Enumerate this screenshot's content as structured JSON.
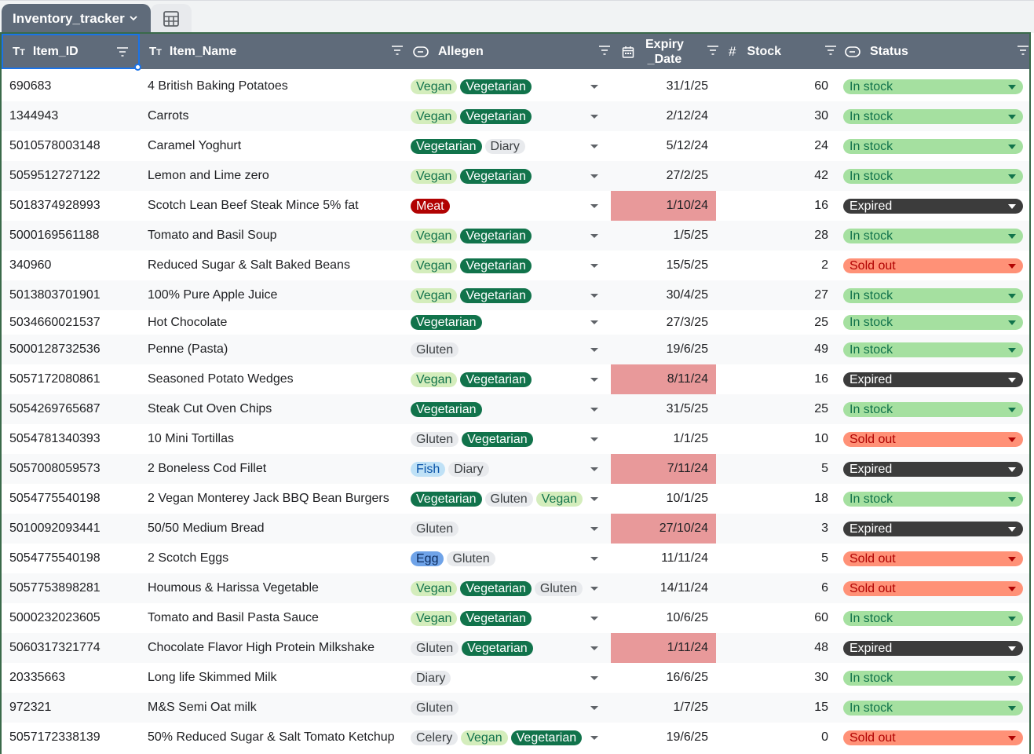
{
  "tabs": {
    "sheet_name": "Inventory_tracker"
  },
  "columns": [
    {
      "key": "item_id",
      "label": "Item_ID",
      "type_icon": "text-type-icon"
    },
    {
      "key": "item_name",
      "label": "Item_Name",
      "type_icon": "text-type-icon"
    },
    {
      "key": "allergen",
      "label": "Allegen",
      "type_icon": "dropdown-chip-icon"
    },
    {
      "key": "expiry",
      "label": "Expiry\n_Date",
      "type_icon": "calendar-icon"
    },
    {
      "key": "stock",
      "label": "Stock",
      "type_icon": "number-hash-icon"
    },
    {
      "key": "status",
      "label": "Status",
      "type_icon": "dropdown-chip-icon"
    }
  ],
  "chip_styles": {
    "Vegan": {
      "bg": "#d4edbc",
      "fg": "#11734b"
    },
    "Vegetarian": {
      "bg": "#11734b",
      "fg": "#ffffff"
    },
    "Diary": {
      "bg": "#e8eaed",
      "fg": "#3c4043"
    },
    "Gluten": {
      "bg": "#e8eaed",
      "fg": "#3c4043"
    },
    "Meat": {
      "bg": "#b10202",
      "fg": "#ffffff"
    },
    "Fish": {
      "bg": "#bfe1f6",
      "fg": "#0a53a8"
    },
    "Egg": {
      "bg": "#6fa3e8",
      "fg": "#0b2a5c"
    },
    "Celery": {
      "bg": "#e8eaed",
      "fg": "#3c4043"
    }
  },
  "status_styles": {
    "In stock": {
      "bg": "#a5e0a0",
      "fg": "#11734b",
      "arrow": "#11734b"
    },
    "Expired": {
      "bg": "#3c3c3c",
      "fg": "#ffffff",
      "arrow": "#ffffff"
    },
    "Sold out": {
      "bg": "#ff9177",
      "fg": "#b10202",
      "arrow": "#b10202"
    }
  },
  "rows": [
    {
      "id": "690683",
      "name": "4 British Baking Potatoes",
      "allergens": [
        "Vegan",
        "Vegetarian"
      ],
      "date": "31/1/25",
      "expired": false,
      "stock": "60",
      "status": "In stock"
    },
    {
      "id": "1344943",
      "name": "Carrots",
      "allergens": [
        "Vegan",
        "Vegetarian"
      ],
      "date": "2/12/24",
      "expired": false,
      "stock": "30",
      "status": "In stock"
    },
    {
      "id": "5010578003148",
      "name": "Caramel Yoghurt",
      "allergens": [
        "Vegetarian",
        "Diary"
      ],
      "date": "5/12/24",
      "expired": false,
      "stock": "24",
      "status": "In stock"
    },
    {
      "id": "5059512727122",
      "name": "Lemon and Lime zero",
      "allergens": [
        "Vegan",
        "Vegetarian"
      ],
      "date": "27/2/25",
      "expired": false,
      "stock": "42",
      "status": "In stock"
    },
    {
      "id": "5018374928993",
      "name": "Scotch Lean Beef Steak Mince 5% fat",
      "allergens": [
        "Meat"
      ],
      "date": "1/10/24",
      "expired": true,
      "stock": "16",
      "status": "Expired"
    },
    {
      "id": "5000169561188",
      "name": "Tomato and Basil Soup",
      "allergens": [
        "Vegan",
        "Vegetarian"
      ],
      "date": "1/5/25",
      "expired": false,
      "stock": "28",
      "status": "In stock"
    },
    {
      "id": "340960",
      "name": "Reduced Sugar & Salt Baked Beans",
      "allergens": [
        "Vegan",
        "Vegetarian"
      ],
      "date": "15/5/25",
      "expired": false,
      "stock": "2",
      "status": "Sold out"
    },
    {
      "id": "5013803701901",
      "name": "100% Pure Apple Juice",
      "allergens": [
        "Vegan",
        "Vegetarian"
      ],
      "date": "30/4/25",
      "expired": false,
      "stock": "27",
      "status": "In stock"
    },
    {
      "id": "5034660021537",
      "name": "Hot Chocolate",
      "allergens": [
        "Vegetarian"
      ],
      "date": "27/3/25",
      "expired": false,
      "stock": "25",
      "status": "In stock"
    },
    {
      "id": "5000128732536",
      "name": "Penne (Pasta)",
      "allergens": [
        "Gluten"
      ],
      "date": "19/6/25",
      "expired": false,
      "stock": "49",
      "status": "In stock"
    },
    {
      "id": "5057172080861",
      "name": "Seasoned Potato Wedges",
      "allergens": [
        "Vegan",
        "Vegetarian"
      ],
      "date": "8/11/24",
      "expired": true,
      "stock": "16",
      "status": "Expired"
    },
    {
      "id": "5054269765687",
      "name": "Steak Cut Oven Chips",
      "allergens": [
        "Vegetarian"
      ],
      "date": "31/5/25",
      "expired": false,
      "stock": "25",
      "status": "In stock"
    },
    {
      "id": "5054781340393",
      "name": "10 Mini Tortillas",
      "allergens": [
        "Gluten",
        "Vegetarian"
      ],
      "date": "1/1/25",
      "expired": false,
      "stock": "10",
      "status": "Sold out"
    },
    {
      "id": "5057008059573",
      "name": "2 Boneless Cod Fillet",
      "allergens": [
        "Fish",
        "Diary"
      ],
      "date": "7/11/24",
      "expired": true,
      "stock": "5",
      "status": "Expired"
    },
    {
      "id": "5054775540198",
      "name": "2 Vegan Monterey Jack BBQ Bean Burgers",
      "allergens": [
        "Vegetarian",
        "Gluten",
        "Vegan"
      ],
      "date": "10/1/25",
      "expired": false,
      "stock": "18",
      "status": "In stock"
    },
    {
      "id": "5010092093441",
      "name": "50/50 Medium Bread",
      "allergens": [
        "Gluten"
      ],
      "date": "27/10/24",
      "expired": true,
      "stock": "3",
      "status": "Expired"
    },
    {
      "id": "5054775540198",
      "name": "2 Scotch Eggs",
      "allergens": [
        "Egg",
        "Gluten"
      ],
      "date": "11/11/24",
      "expired": false,
      "stock": "5",
      "status": "Sold out"
    },
    {
      "id": "5057753898281",
      "name": "Houmous & Harissa Vegetable",
      "allergens": [
        "Vegan",
        "Vegetarian",
        "Gluten"
      ],
      "date": "14/11/24",
      "expired": false,
      "stock": "6",
      "status": "Sold out"
    },
    {
      "id": "5000232023605",
      "name": "Tomato and Basil Pasta Sauce",
      "allergens": [
        "Vegan",
        "Vegetarian"
      ],
      "date": "10/6/25",
      "expired": false,
      "stock": "60",
      "status": "In stock"
    },
    {
      "id": "5060317321774",
      "name": "Chocolate Flavor High Protein Milkshake",
      "allergens": [
        "Gluten",
        "Vegetarian"
      ],
      "date": "1/11/24",
      "expired": true,
      "stock": "48",
      "status": "Expired"
    },
    {
      "id": "20335663",
      "name": "Long life Skimmed Milk",
      "allergens": [
        "Diary"
      ],
      "date": "16/6/25",
      "expired": false,
      "stock": "30",
      "status": "In stock"
    },
    {
      "id": "972321",
      "name": "M&S Semi Oat milk",
      "allergens": [
        "Gluten"
      ],
      "date": "1/7/25",
      "expired": false,
      "stock": "15",
      "status": "In stock"
    },
    {
      "id": "5057172338139",
      "name": "50% Reduced Sugar & Salt Tomato Ketchup",
      "allergens": [
        "Celery",
        "Vegan",
        "Vegetarian"
      ],
      "date": "19/6/25",
      "expired": false,
      "stock": "0",
      "status": "Sold out"
    }
  ]
}
